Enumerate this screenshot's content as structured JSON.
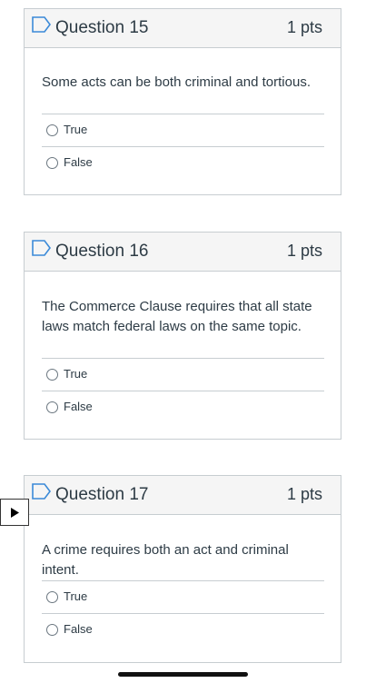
{
  "questions": [
    {
      "title": "Question 15",
      "points": "1 pts",
      "text": "Some acts can be both criminal and tortious.",
      "answers": [
        "True",
        "False"
      ]
    },
    {
      "title": "Question 16",
      "points": "1 pts",
      "text": "The Commerce Clause requires that all state laws match federal laws on the same topic.",
      "answers": [
        "True",
        "False"
      ]
    },
    {
      "title": "Question 17",
      "points": "1 pts",
      "text": "A crime requires both an act and criminal intent.",
      "answers": [
        "True",
        "False"
      ]
    }
  ],
  "colors": {
    "border": "#c7cdd1",
    "header_bg": "#f5f5f5",
    "flag": "#3b8ad8",
    "text": "#2d3b45"
  },
  "icons": {
    "flag": "bookmark-flag-icon",
    "play": "play-icon"
  }
}
